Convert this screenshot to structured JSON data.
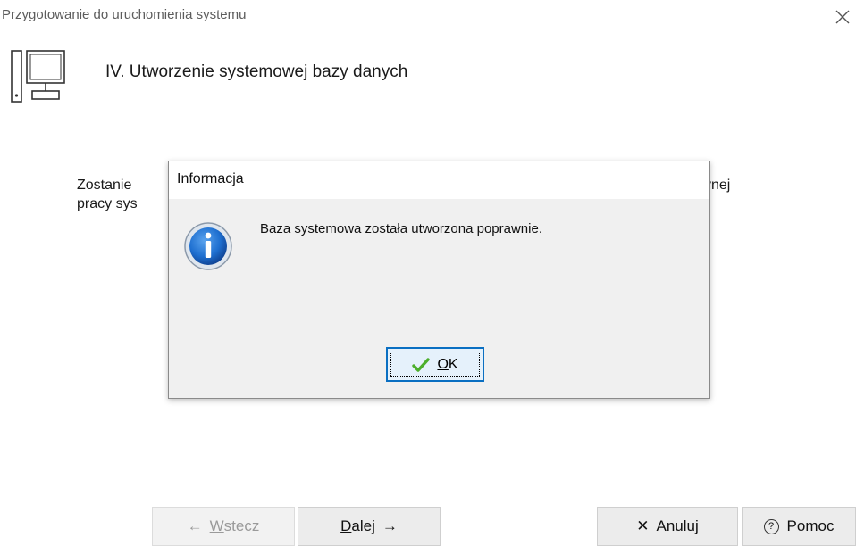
{
  "window": {
    "title": "Przygotowanie do uruchomienia systemu",
    "close_icon": "close-icon"
  },
  "step": {
    "icon": "computer-icon",
    "title": "IV. Utworzenie systemowej bazy danych"
  },
  "description": {
    "line1_start": "Zostanie",
    "line1_end": "ynej",
    "line2_start": "pracy sys"
  },
  "dialog": {
    "title": "Informacja",
    "icon": "info-icon",
    "message": "Baza systemowa została utworzona poprawnie.",
    "ok_label_mnemonic": "O",
    "ok_label_rest": "K"
  },
  "buttons": {
    "back": {
      "arrow": "←",
      "mnemonic": "W",
      "rest": "stecz",
      "disabled": true
    },
    "next": {
      "mnemonic": "D",
      "rest": "alej",
      "arrow": "→"
    },
    "cancel": {
      "icon": "✕",
      "label": "Anuluj"
    },
    "help": {
      "icon": "?",
      "label": "Pomoc"
    }
  },
  "colors": {
    "accent": "#0a6fc2",
    "dialog_bg": "#f0f0f0",
    "info_blue": "#1565c0",
    "check_green": "#4caf2c"
  }
}
